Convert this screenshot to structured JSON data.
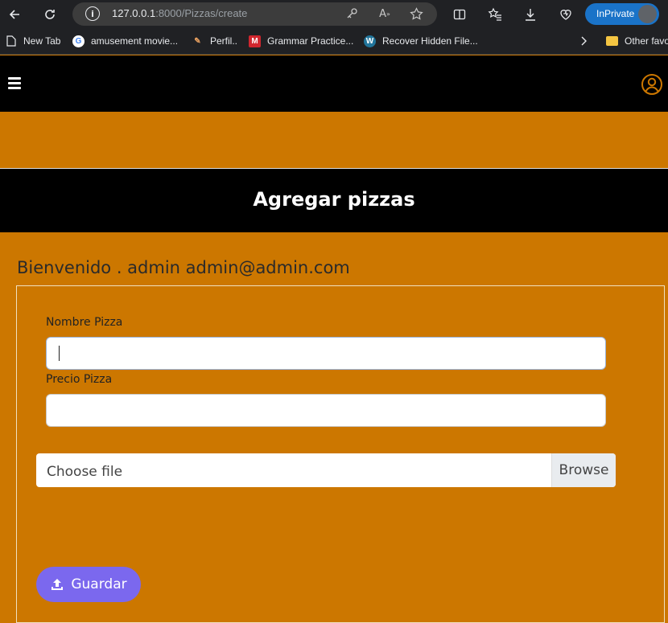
{
  "browser": {
    "url_host": "127.0.0.1",
    "url_rest": ":8000/Pizzas/create",
    "inprivate_label": "InPrivate",
    "bookmarks": [
      {
        "label": "New Tab",
        "icon": "page-icon"
      },
      {
        "label": "amusement movie...",
        "icon": "google-icon"
      },
      {
        "label": "Perfil..",
        "icon": "brush-icon"
      },
      {
        "label": "Grammar Practice...",
        "icon": "m-icon"
      },
      {
        "label": "Recover Hidden File...",
        "icon": "wordpress-icon"
      }
    ],
    "other_favorites": "Other favo"
  },
  "header": {
    "title": "Agregar pizzas"
  },
  "welcome": "Bienvenido . admin admin@admin.com",
  "form": {
    "name_label": "Nombre Pizza",
    "name_value": "",
    "price_label": "Precio Pizza",
    "price_value": "",
    "file_placeholder": "Choose file",
    "browse_label": "Browse",
    "save_label": "Guardar"
  },
  "colors": {
    "accent": "#cc7700",
    "button": "#7b68ee",
    "nav": "#000000"
  }
}
